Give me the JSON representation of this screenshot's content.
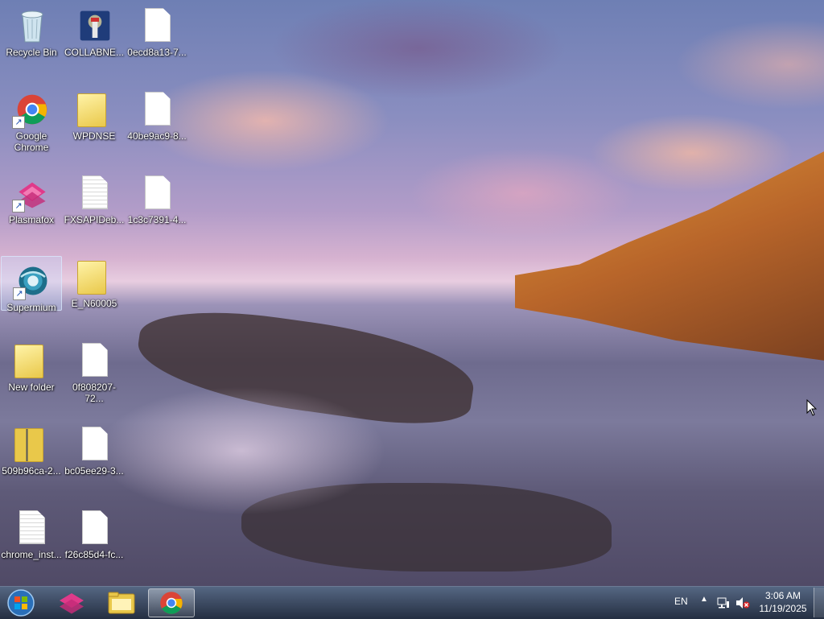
{
  "desktop": {
    "icons": [
      {
        "label": "Recycle Bin"
      },
      {
        "label": "COLLABNE..."
      },
      {
        "label": "0ecd8a13-7..."
      },
      {
        "label": "Google Chrome"
      },
      {
        "label": "WPDNSE"
      },
      {
        "label": "40be9ac9-8..."
      },
      {
        "label": "Plasmafox"
      },
      {
        "label": "FXSAPIDeb..."
      },
      {
        "label": "1c3c7391-4..."
      },
      {
        "label": "Supermium"
      },
      {
        "label": "E_N60005"
      },
      {
        "label": "New folder"
      },
      {
        "label": "0f808207-72..."
      },
      {
        "label": "509b96ca-2..."
      },
      {
        "label": "bc05ee29-3..."
      },
      {
        "label": "chrome_inst..."
      },
      {
        "label": "f26c85d4-fc..."
      }
    ]
  },
  "taskbar": {
    "language": "EN",
    "time": "3:06 AM",
    "date": "11/19/2025"
  },
  "colors": {
    "taskbar": "#1e2a40",
    "selection": "#c8dcff"
  }
}
